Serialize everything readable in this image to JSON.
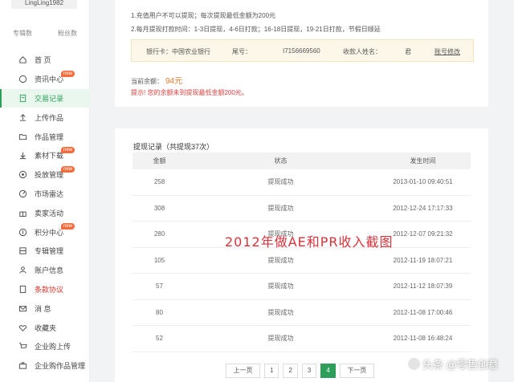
{
  "sidebar": {
    "username": "LingLing1982",
    "stats": [
      "专辑数",
      "粉丝数"
    ],
    "items": [
      {
        "label": "首 页",
        "icon": "home-icon"
      },
      {
        "label": "资讯中心",
        "icon": "chat-icon",
        "badge": "new"
      },
      {
        "label": "交易记录",
        "icon": "clipboard-icon",
        "active": true
      },
      {
        "label": "上传作品",
        "icon": "upload-icon"
      },
      {
        "label": "作品管理",
        "icon": "folder-icon"
      },
      {
        "label": "素材下载",
        "icon": "download-icon",
        "badge": "new"
      },
      {
        "label": "投放管理",
        "icon": "target-icon",
        "badge": "new"
      },
      {
        "label": "市场雷达",
        "icon": "radar-icon"
      },
      {
        "label": "卖家活动",
        "icon": "gift-icon"
      },
      {
        "label": "积分中心",
        "icon": "coin-icon",
        "badge": "new"
      },
      {
        "label": "专辑管理",
        "icon": "album-icon"
      },
      {
        "label": "账户信息",
        "icon": "user-icon"
      },
      {
        "label": "条款协议",
        "icon": "document-icon",
        "red": true
      },
      {
        "label": "消 息",
        "icon": "mail-icon"
      },
      {
        "label": "收藏夹",
        "icon": "heart-icon"
      },
      {
        "label": "企业购上传",
        "icon": "cart-icon"
      },
      {
        "label": "企业购作品管理",
        "icon": "briefcase-icon"
      }
    ]
  },
  "withdraw": {
    "rules": [
      "1.充值用户不可以提现；每次提现最低金额为200元",
      "2.每月提现打款时间：1-3日提现，4-6日打款；16-18日提现，19-21日打款，节假日顺延"
    ],
    "bank_label": "银行卡：",
    "bank_name": "中国农业银行",
    "tail_label": "尾号：",
    "tail_number": "I7156669560",
    "payee_label": "收款人姓名：",
    "payee_name": "君",
    "edit_link": "账号修改",
    "balance_label": "当前余额：",
    "balance_value": "94元",
    "warning": "提示! 您的余额未到提现最低金额200元。"
  },
  "records": {
    "title": "提现记录（共提现37次）",
    "columns": [
      "金额",
      "状态",
      "发生时间"
    ],
    "rows": [
      {
        "amount": "258",
        "status": "提现成功",
        "time": "2013-01-10 09:40:51"
      },
      {
        "amount": "308",
        "status": "提现成功",
        "time": "2012-12-24 17:17:33"
      },
      {
        "amount": "280",
        "status": "提现成功",
        "time": "2012-12-07 09:21:32"
      },
      {
        "amount": "105",
        "status": "提现成功",
        "time": "2012-11-19 18:07:21"
      },
      {
        "amount": "57",
        "status": "提现成功",
        "time": "2012-11-12 18:07:39"
      },
      {
        "amount": "80",
        "status": "提现成功",
        "time": "2012-11-08 17:00:46"
      },
      {
        "amount": "52",
        "status": "提现成功",
        "time": "2012-11-08 16:48:24"
      }
    ]
  },
  "pagination": {
    "prev": "上一页",
    "pages": [
      "1",
      "2",
      "3",
      "4"
    ],
    "current": "4",
    "next": "下一页"
  },
  "overlay_caption": "2012年做AE和PR收入截图",
  "watermark": "头条 @零售创意",
  "colors": {
    "accent": "#2d9f5a",
    "warning": "#e23b3b",
    "balance": "#f07a2f",
    "badge": "#f56c3d"
  }
}
